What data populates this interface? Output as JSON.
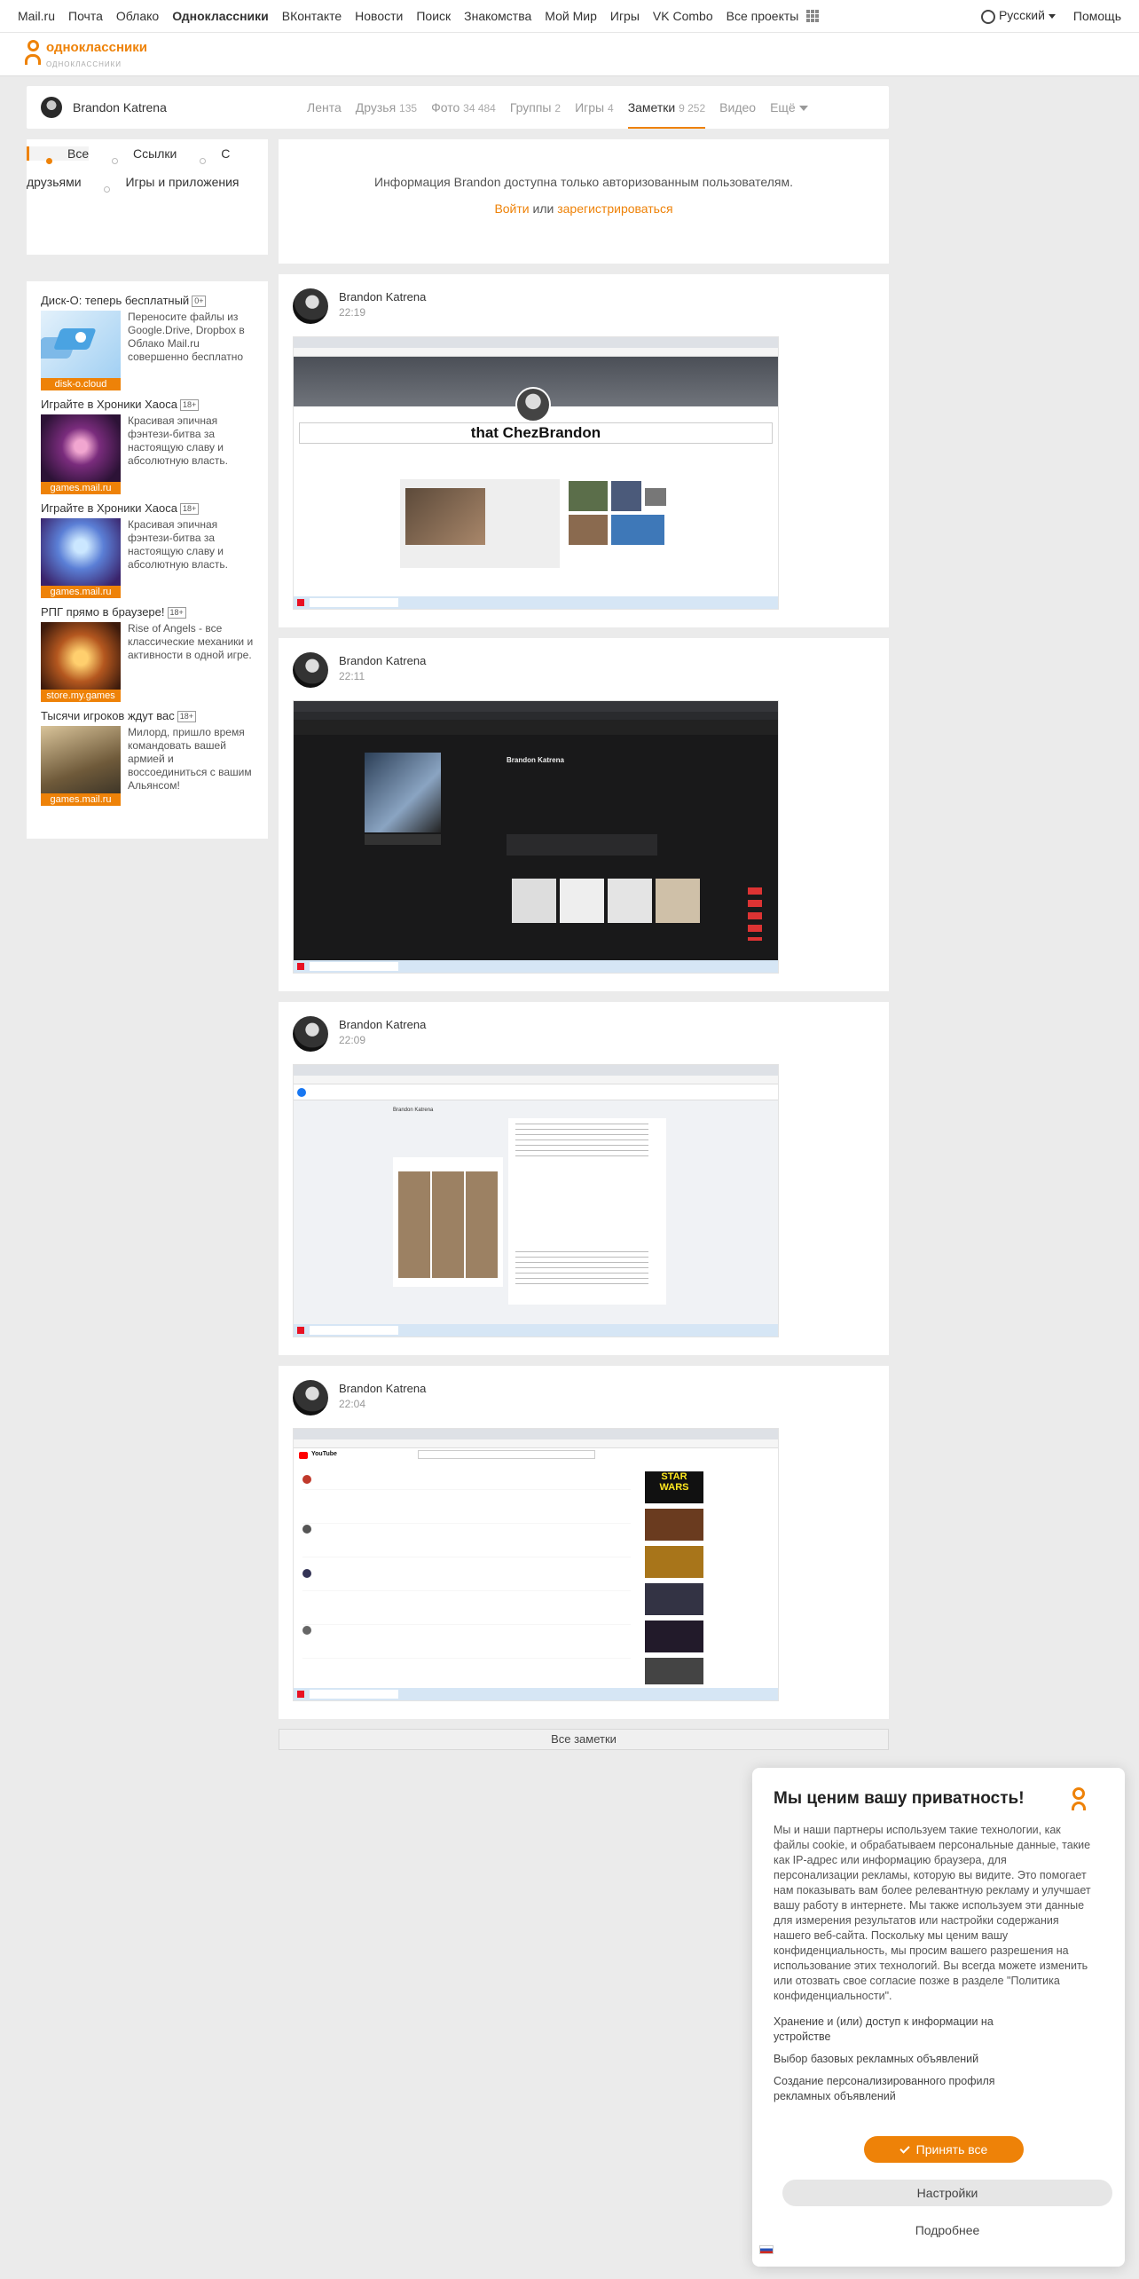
{
  "topbar": {
    "items": [
      "Mail.ru",
      "Почта",
      "Облако",
      "Одноклассники",
      "ВКонтакте",
      "Новости",
      "Поиск",
      "Знакомства",
      "Мой Мир",
      "Игры",
      "VK Combo",
      "Все проекты"
    ],
    "language": "Русский",
    "help": "Помощь"
  },
  "logo": {
    "name": "одноклассники",
    "sub": "ОДНОКЛАССНИКИ"
  },
  "profile": {
    "name": "Brandon Katrena",
    "tabs": [
      {
        "label": "Лента",
        "count": ""
      },
      {
        "label": "Друзья",
        "count": "135"
      },
      {
        "label": "Фото",
        "count": "34 484"
      },
      {
        "label": "Группы",
        "count": "2"
      },
      {
        "label": "Игры",
        "count": "4"
      },
      {
        "label": "Заметки",
        "count": "9 252"
      },
      {
        "label": "Видео",
        "count": ""
      },
      {
        "label": "Ещё",
        "count": ""
      }
    ]
  },
  "leftnav": {
    "items": [
      "Все",
      "Ссылки",
      "С друзьями",
      "Игры и приложения"
    ]
  },
  "ads": [
    {
      "title": "Диск-О: теперь бесплатный",
      "age": "0+",
      "text": "Переносите файлы из Google.Drive, Dropbox в Облако Mail.ru совершенно бесплатно",
      "caption": "disk-o.cloud"
    },
    {
      "title": "Играйте в Хроники Хаоса",
      "age": "18+",
      "text": "Красивая эпичная фэнтези-битва за настоящую славу и абсолютную власть.",
      "caption": "games.mail.ru"
    },
    {
      "title": "Играйте в Хроники Хаоса",
      "age": "18+",
      "text": "Красивая эпичная фэнтези-битва за настоящую славу и абсолютную власть.",
      "caption": "games.mail.ru"
    },
    {
      "title": "РПГ прямо в браузере!",
      "age": "18+",
      "text": "Rise of Angels - все классические механики и активности в одной игре.",
      "caption": "store.my.games"
    },
    {
      "title": "Тысячи игроков ждут вас",
      "age": "18+",
      "text": "Милорд, пришло время командовать вашей армией и воссоединиться с вашим Альянсом!",
      "caption": "games.mail.ru"
    }
  ],
  "auth": {
    "message": "Информация Brandon доступна только авторизованным пользователям.",
    "login": "Войти",
    "or": "или",
    "register": "зарегистрироваться"
  },
  "posts": [
    {
      "author": "Brandon Katrena",
      "time": "22:19",
      "shot_heading": "that ChezBrandon"
    },
    {
      "author": "Brandon Katrena",
      "time": "22:11",
      "shot_heading": "Brandon Katrena"
    },
    {
      "author": "Brandon Katrena",
      "time": "22:09",
      "shot_heading": "Brandon Katrena"
    },
    {
      "author": "Brandon Katrena",
      "time": "22:04",
      "shot_heading": "YouTube"
    }
  ],
  "all_notes": "Все заметки",
  "privacy": {
    "title": "Мы ценим вашу приватность!",
    "text": "Мы и наши партнеры используем такие технологии, как файлы cookie, и обрабатываем персональные данные, такие как IP-адрес или информацию браузера, для персонализации рекламы, которую вы видите. Это помогает нам показывать вам более релевантную рекламу и улучшает вашу работу в интернете. Мы также используем эти данные для измерения результатов или настройки содержания нашего веб-сайта. Поскольку мы ценим вашу конфиденциальность, мы просим вашего разрешения на использование этих технологий. Вы всегда можете изменить или отозвать свое согласие позже в разделе \"Политика конфиденциальности\".",
    "options": [
      "Хранение и (или) доступ к информации на устройстве",
      "Выбор базовых рекламных объявлений",
      "Создание персонализированного профиля рекламных объявлений"
    ],
    "accept": "Принять все",
    "settings": "Настройки",
    "more": "Подробнее"
  },
  "colors": {
    "accent": "#ee8208",
    "background": "#ebebeb"
  }
}
